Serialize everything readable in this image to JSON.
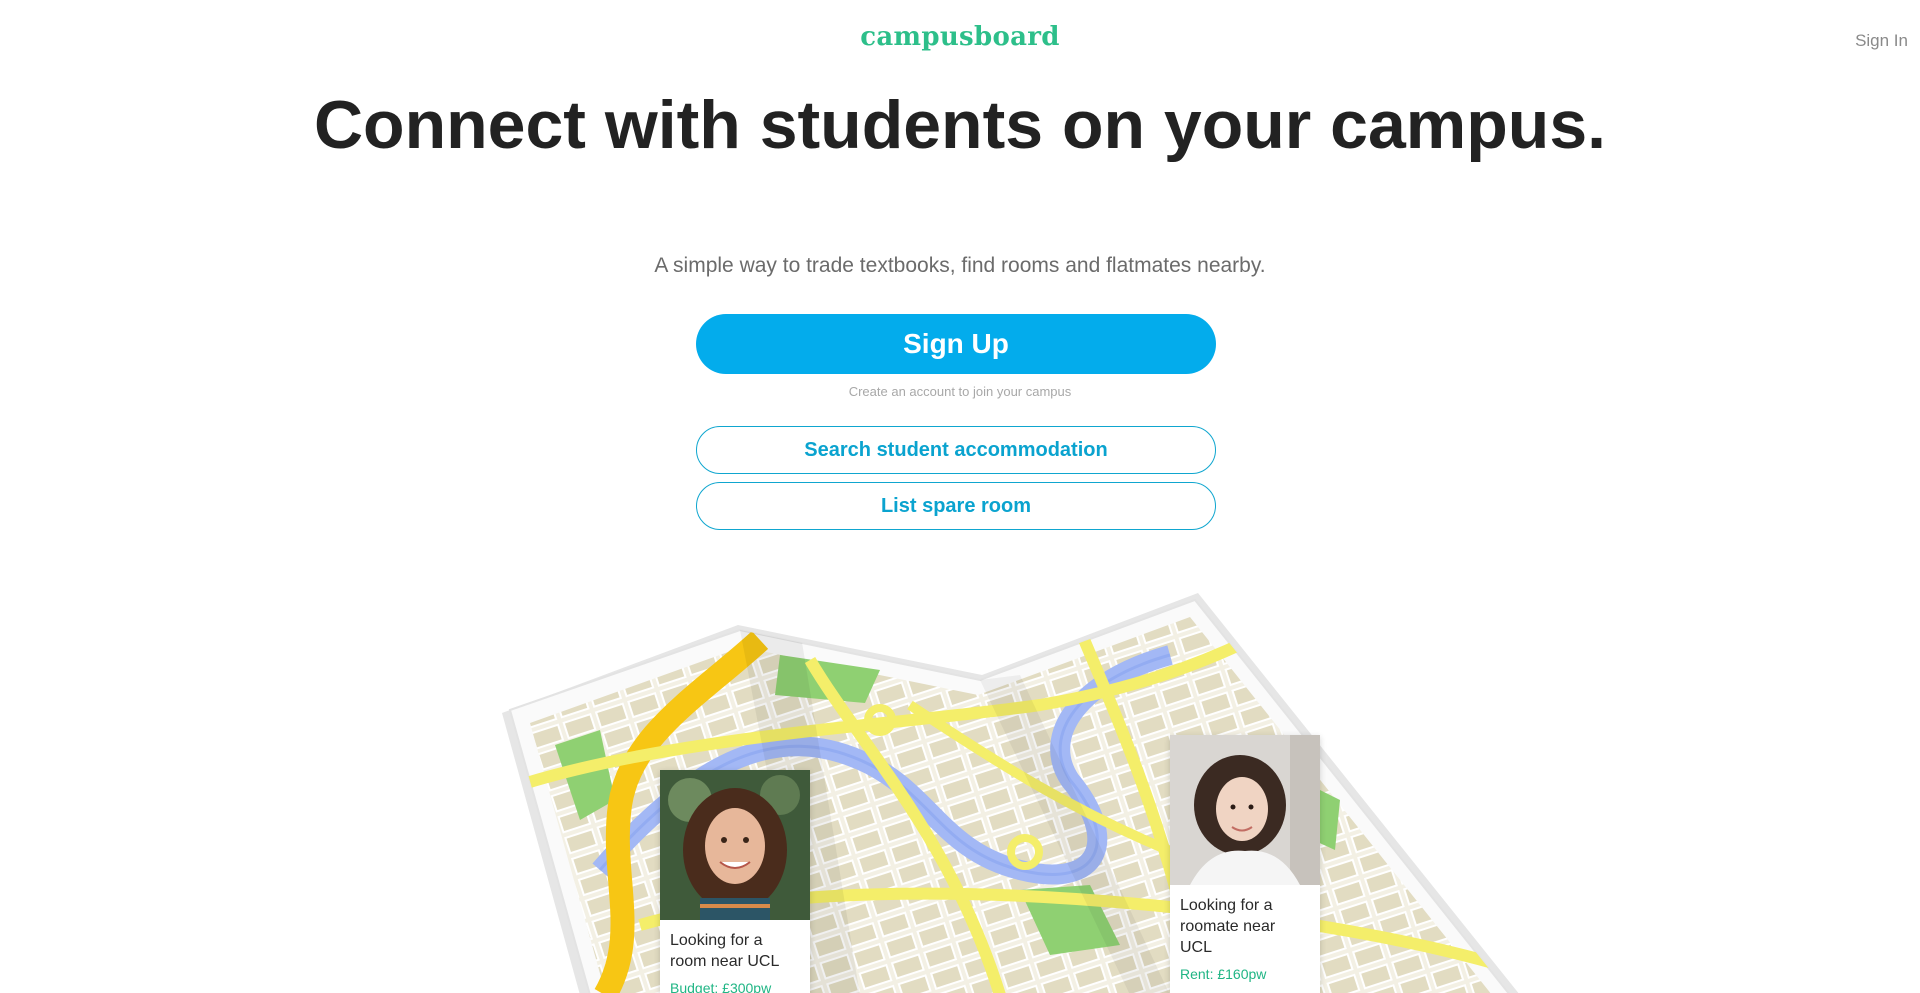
{
  "header": {
    "brand": "campusboard",
    "sign_in": "Sign In"
  },
  "hero": {
    "title": "Connect with students on your campus.",
    "subtitle": "A simple way to trade textbooks, find rooms and flatmates nearby."
  },
  "actions": {
    "sign_up": "Sign Up",
    "sign_up_caption": "Create an account to join your campus",
    "search_accommodation": "Search student accommodation",
    "list_room": "List spare room"
  },
  "cards": [
    {
      "text": "Looking for a room near UCL",
      "money": "Budget: £300pw"
    },
    {
      "text": "Looking for a roomate near UCL",
      "money": "Rent: £160pw"
    }
  ],
  "colors": {
    "brand": "#2dbf8a",
    "primary": "#03acec",
    "outline": "#0fa6cf",
    "money": "#1fb584"
  }
}
